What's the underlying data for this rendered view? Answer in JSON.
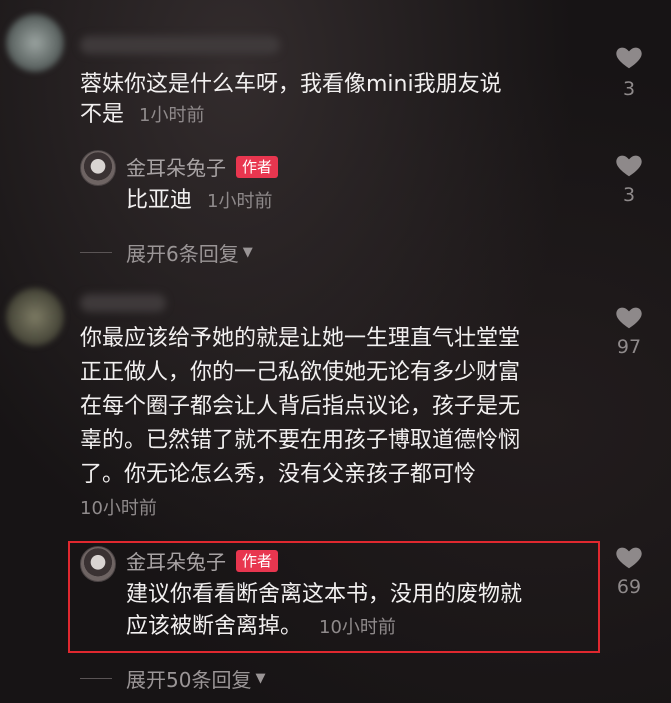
{
  "comments": [
    {
      "text": "蓉妹你这是什么车呀，我看像mini我朋友说不是",
      "line1": "蓉妹你这是什么车呀，我看像mini我朋友说",
      "line2": "不是",
      "time": "1小时前",
      "likes": "3",
      "reply": {
        "author": "金耳朵兔子",
        "badge": "作者",
        "text": "比亚迪",
        "time": "1小时前",
        "likes": "3"
      },
      "expand": "展开6条回复"
    },
    {
      "lines": [
        "你最应该给予她的就是让她一生理直气壮堂堂",
        "正正做人，你的一己私欲使她无论有多少财富",
        "在每个圈子都会让人背后指点议论，孩子是无",
        "辜的。已然错了就不要在用孩子博取道德怜悯",
        "了。你无论怎么秀，没有父亲孩子都可怜"
      ],
      "time": "10小时前",
      "likes": "97",
      "reply": {
        "author": "金耳朵兔子",
        "badge": "作者",
        "line1": "建议你看看断舍离这本书，没用的废物就",
        "line2": "应该被断舍离掉。",
        "time": "10小时前",
        "likes": "69"
      },
      "expand": "展开50条回复"
    }
  ],
  "icons": {
    "like": "heart-icon",
    "expand": "caret-down-icon"
  },
  "colors": {
    "badge": "#e8364f",
    "highlight": "#e0282f",
    "background": "#1a1718"
  }
}
